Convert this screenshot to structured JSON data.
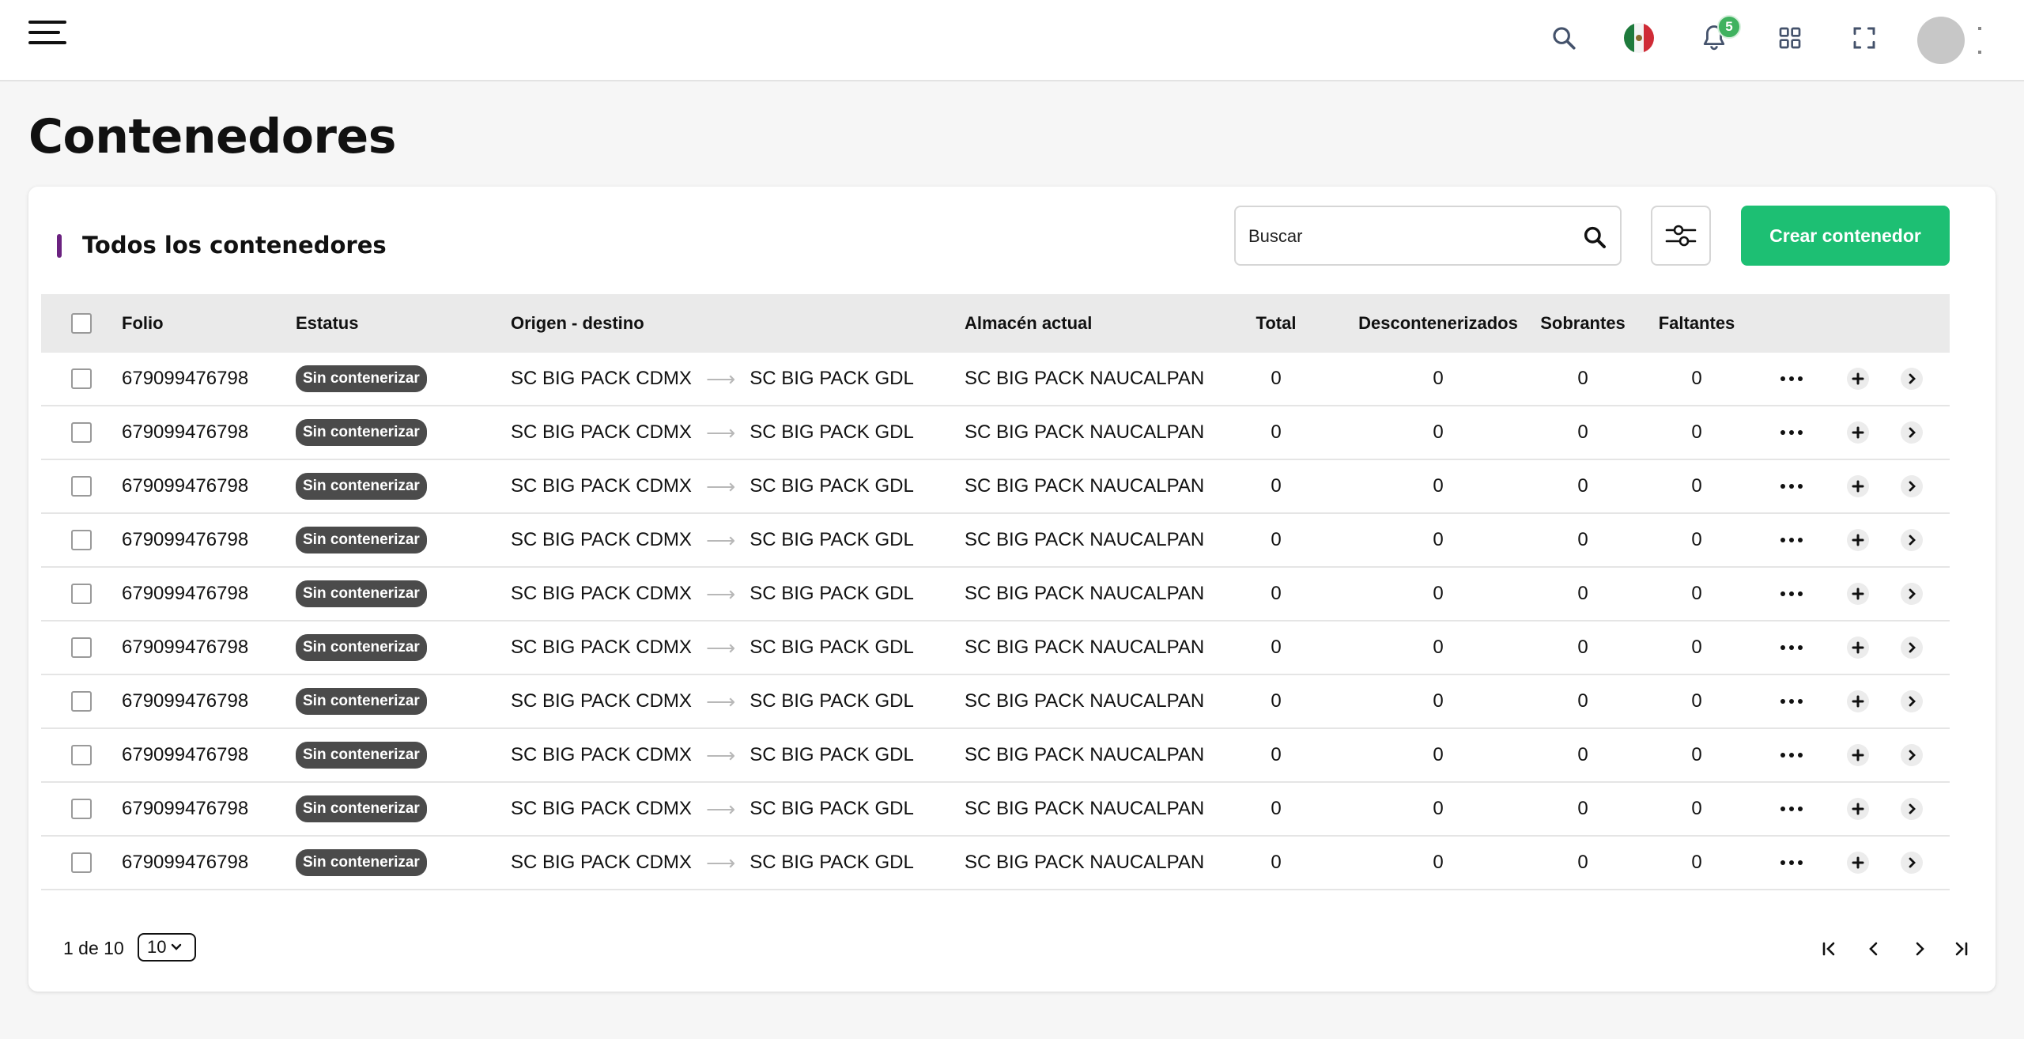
{
  "header": {
    "notifications_count": "5",
    "icons": [
      "menu-icon",
      "search-icon",
      "mexico-flag-icon",
      "bell-icon",
      "apps-grid-icon",
      "fullscreen-icon",
      "avatar"
    ]
  },
  "page": {
    "title": "Contenedores"
  },
  "card": {
    "title": "Todos los contenedores",
    "search_placeholder": "Buscar",
    "create_label": "Crear contenedor",
    "accent_color": "#6b2280",
    "button_color": "#1dbf73"
  },
  "table": {
    "columns": [
      "Folio",
      "Estatus",
      "Origen - destino",
      "Almacén actual",
      "Total",
      "Descontenerizados",
      "Sobrantes",
      "Faltantes"
    ],
    "rows": [
      {
        "folio": "679099476798",
        "status": "Sin contenerizar",
        "origin": "SC BIG PACK CDMX",
        "destination": "SC BIG PACK GDL",
        "warehouse": "SC BIG PACK NAUCALPAN",
        "total": "0",
        "decont": "0",
        "sobrantes": "0",
        "faltantes": "0"
      },
      {
        "folio": "679099476798",
        "status": "Sin contenerizar",
        "origin": "SC BIG PACK CDMX",
        "destination": "SC BIG PACK GDL",
        "warehouse": "SC BIG PACK NAUCALPAN",
        "total": "0",
        "decont": "0",
        "sobrantes": "0",
        "faltantes": "0"
      },
      {
        "folio": "679099476798",
        "status": "Sin contenerizar",
        "origin": "SC BIG PACK CDMX",
        "destination": "SC BIG PACK GDL",
        "warehouse": "SC BIG PACK NAUCALPAN",
        "total": "0",
        "decont": "0",
        "sobrantes": "0",
        "faltantes": "0"
      },
      {
        "folio": "679099476798",
        "status": "Sin contenerizar",
        "origin": "SC BIG PACK CDMX",
        "destination": "SC BIG PACK GDL",
        "warehouse": "SC BIG PACK NAUCALPAN",
        "total": "0",
        "decont": "0",
        "sobrantes": "0",
        "faltantes": "0"
      },
      {
        "folio": "679099476798",
        "status": "Sin contenerizar",
        "origin": "SC BIG PACK CDMX",
        "destination": "SC BIG PACK GDL",
        "warehouse": "SC BIG PACK NAUCALPAN",
        "total": "0",
        "decont": "0",
        "sobrantes": "0",
        "faltantes": "0"
      },
      {
        "folio": "679099476798",
        "status": "Sin contenerizar",
        "origin": "SC BIG PACK CDMX",
        "destination": "SC BIG PACK GDL",
        "warehouse": "SC BIG PACK NAUCALPAN",
        "total": "0",
        "decont": "0",
        "sobrantes": "0",
        "faltantes": "0"
      },
      {
        "folio": "679099476798",
        "status": "Sin contenerizar",
        "origin": "SC BIG PACK CDMX",
        "destination": "SC BIG PACK GDL",
        "warehouse": "SC BIG PACK NAUCALPAN",
        "total": "0",
        "decont": "0",
        "sobrantes": "0",
        "faltantes": "0"
      },
      {
        "folio": "679099476798",
        "status": "Sin contenerizar",
        "origin": "SC BIG PACK CDMX",
        "destination": "SC BIG PACK GDL",
        "warehouse": "SC BIG PACK NAUCALPAN",
        "total": "0",
        "decont": "0",
        "sobrantes": "0",
        "faltantes": "0"
      },
      {
        "folio": "679099476798",
        "status": "Sin contenerizar",
        "origin": "SC BIG PACK CDMX",
        "destination": "SC BIG PACK GDL",
        "warehouse": "SC BIG PACK NAUCALPAN",
        "total": "0",
        "decont": "0",
        "sobrantes": "0",
        "faltantes": "0"
      },
      {
        "folio": "679099476798",
        "status": "Sin contenerizar",
        "origin": "SC BIG PACK CDMX",
        "destination": "SC BIG PACK GDL",
        "warehouse": "SC BIG PACK NAUCALPAN",
        "total": "0",
        "decont": "0",
        "sobrantes": "0",
        "faltantes": "0"
      }
    ]
  },
  "pagination": {
    "page_text": "1 de 10",
    "page_size": "10"
  }
}
